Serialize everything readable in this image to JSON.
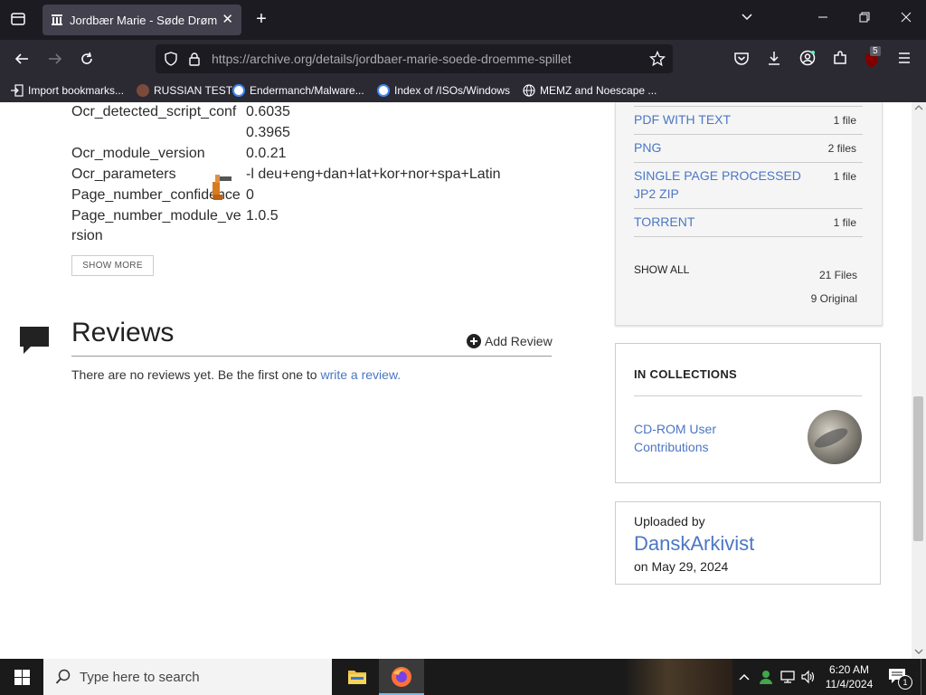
{
  "browser": {
    "tab_title": "Jordbær Marie - Søde Drømme",
    "tab_close": "✕",
    "new_tab": "+",
    "url_host": "https://archive.org",
    "url_path": "/details/jordbaer-marie-soede-droemme-spillet",
    "extension_badge": "5",
    "bookmarks": [
      {
        "label": "Import bookmarks..."
      },
      {
        "label": "RUSSIAN TEST"
      },
      {
        "label": "Endermanch/Malware..."
      },
      {
        "label": "Index of /ISOs/Windows"
      },
      {
        "label": "MEMZ and Noescape ..."
      }
    ]
  },
  "metadata": {
    "rows": [
      {
        "key": "Ocr_detected_script_conf",
        "value": "0.6035"
      },
      {
        "key": "",
        "value": "0.3965"
      },
      {
        "key": "Ocr_module_version",
        "value": "0.0.21"
      },
      {
        "key": "Ocr_parameters",
        "value": "-l deu+eng+dan+lat+kor+nor+spa+Latin"
      },
      {
        "key": "Page_number_confidence",
        "value": "0"
      },
      {
        "key": "Page_number_module_ve",
        "value": "1.0.5"
      },
      {
        "key": "rsion",
        "value": ""
      }
    ],
    "show_more": "SHOW MORE"
  },
  "reviews": {
    "title": "Reviews",
    "add_review": "Add Review",
    "empty_text": "There are no reviews yet. Be the first one to ",
    "empty_link": "write a review."
  },
  "downloads": {
    "items": [
      {
        "name": "PDF WITH TEXT",
        "count": "1 file"
      },
      {
        "name": "PNG",
        "count": "2 files"
      },
      {
        "name": "SINGLE PAGE PROCESSED JP2 ZIP",
        "count": "1 file"
      },
      {
        "name": "TORRENT",
        "count": "1 file"
      }
    ],
    "show_all": "SHOW ALL",
    "total_files": "21 Files",
    "original": "9 Original"
  },
  "collections": {
    "heading": "IN COLLECTIONS",
    "item": "CD-ROM User Contributions"
  },
  "uploader": {
    "label": "Uploaded by",
    "name": "DanskArkivist",
    "date": "on May 29, 2024"
  },
  "taskbar": {
    "search_placeholder": "Type here to search",
    "time": "6:20 AM",
    "date": "11/4/2024",
    "notification_count": "1"
  }
}
